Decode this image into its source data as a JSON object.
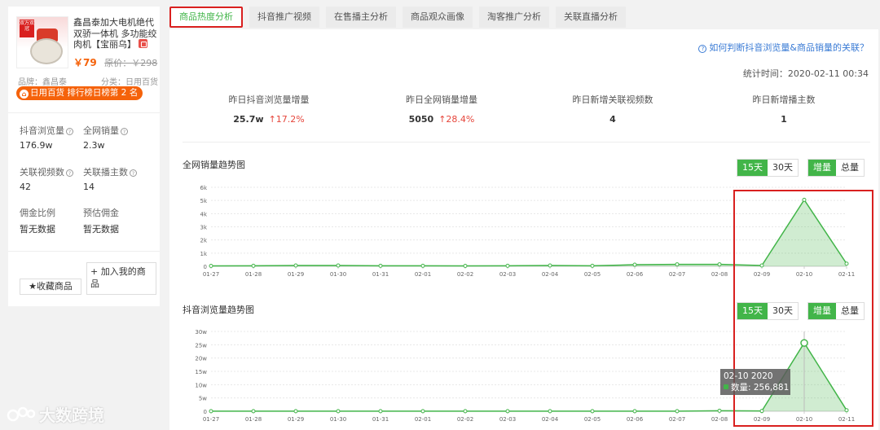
{
  "product": {
    "title": "鑫昌泰加大电机绝代双骄一体机 多功能绞肉机【宝丽乌】",
    "price": "￥79",
    "original_price": "原价：￥298",
    "brand": "品牌：鑫昌泰",
    "category": "分类：日用百货",
    "rank_badge": "日用百货 排行榜日榜第 2 名",
    "image_badge": "双万双冠"
  },
  "left_stats": [
    {
      "label": "抖音浏览量",
      "value": "176.9w"
    },
    {
      "label": "全网销量",
      "value": "2.3w"
    },
    {
      "label": "关联视频数",
      "value": "42"
    },
    {
      "label": "关联播主数",
      "value": "14"
    },
    {
      "label": "佣金比例",
      "value": "暂无数据"
    },
    {
      "label": "预估佣金",
      "value": "暂无数据"
    }
  ],
  "buttons": {
    "add_to_mine": "+ 加入我的商品",
    "favorite": "★收藏商品"
  },
  "tabs": [
    "商品热度分析",
    "抖音推广视频",
    "在售播主分析",
    "商品观众画像",
    "淘客推广分析",
    "关联直播分析"
  ],
  "help_link": "如何判断抖音浏览量&商品销量的关联？",
  "stat_time": "统计时间：2020-02-11 00:34",
  "kpis": [
    {
      "label": "昨日抖音浏览量增量",
      "value": "25.7w",
      "change": "↑17.2%"
    },
    {
      "label": "昨日全网销量增量",
      "value": "5050",
      "change": "↑28.4%"
    },
    {
      "label": "昨日新增关联视频数",
      "value": "4",
      "change": ""
    },
    {
      "label": "昨日新增播主数",
      "value": "1",
      "change": ""
    }
  ],
  "toggles": {
    "d15": "15天",
    "d30": "30天",
    "incr": "增量",
    "total": "总量"
  },
  "colors": {
    "accent": "#42b549",
    "price": "#f5620a",
    "link": "#3a7bd5",
    "highlight": "#d9201f",
    "up": "#e6463c"
  },
  "tooltip": {
    "date": "02-10 2020",
    "text": "数量: 256,881"
  },
  "watermark": "大数跨境",
  "chart_data": [
    {
      "type": "area",
      "title": "全网销量趋势图",
      "x": [
        "01-27",
        "01-28",
        "01-29",
        "01-30",
        "01-31",
        "02-01",
        "02-02",
        "02-03",
        "02-04",
        "02-05",
        "02-06",
        "02-07",
        "02-08",
        "02-09",
        "02-10",
        "02-11"
      ],
      "y_ticks": [
        "0",
        "1k",
        "2k",
        "3k",
        "4k",
        "5k",
        "6k"
      ],
      "ylim": [
        0,
        6000
      ],
      "values": [
        30,
        40,
        60,
        60,
        40,
        40,
        30,
        40,
        60,
        40,
        120,
        150,
        150,
        60,
        5050,
        200
      ]
    },
    {
      "type": "area",
      "title": "抖音浏览量趋势图",
      "x": [
        "01-27",
        "01-28",
        "01-29",
        "01-30",
        "01-31",
        "02-01",
        "02-02",
        "02-03",
        "02-04",
        "02-05",
        "02-06",
        "02-07",
        "02-08",
        "02-09",
        "02-10",
        "02-11"
      ],
      "y_ticks": [
        "0",
        "5w",
        "10w",
        "15w",
        "20w",
        "25w",
        "30w"
      ],
      "ylim": [
        0,
        300000
      ],
      "values": [
        500,
        500,
        500,
        500,
        500,
        500,
        500,
        500,
        500,
        500,
        500,
        500,
        2000,
        1000,
        256881,
        4000
      ]
    }
  ]
}
